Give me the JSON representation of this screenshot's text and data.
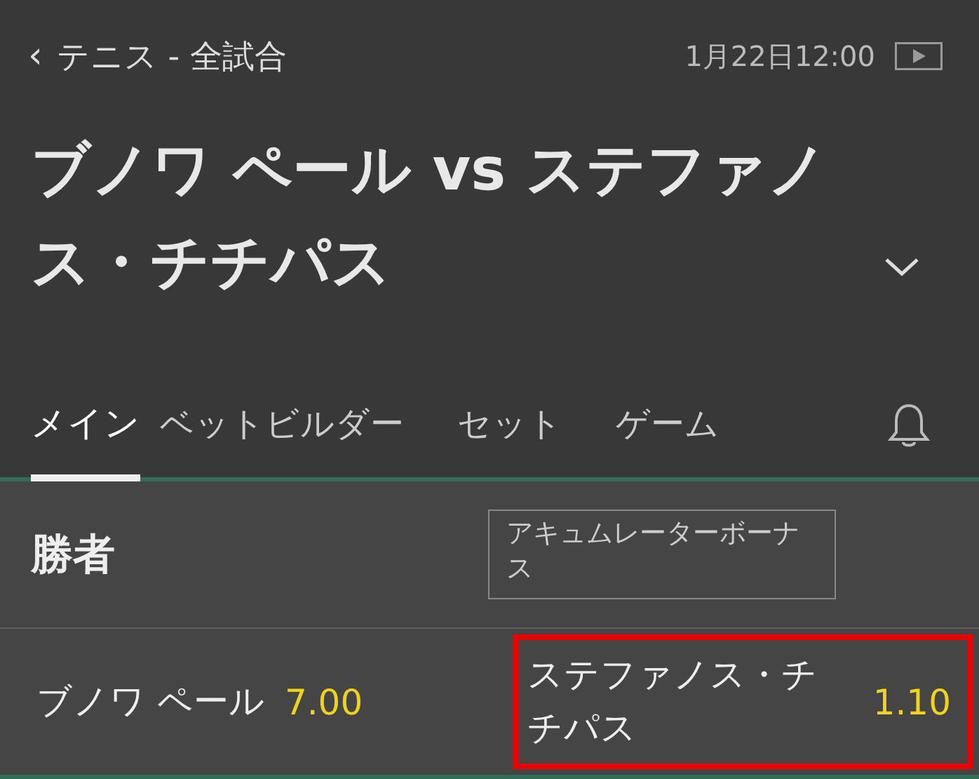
{
  "header": {
    "back": "‹",
    "breadcrumb": "テニス - 全試合",
    "datetime": "1月22日12:00"
  },
  "match": {
    "title": "ブノワ ペール vs ステファノス・チチパス"
  },
  "tabs": [
    {
      "label": "メイン",
      "selected": true
    },
    {
      "label": "ベットビルダー",
      "selected": false
    },
    {
      "label": "セット",
      "selected": false
    },
    {
      "label": "ゲーム",
      "selected": false
    }
  ],
  "market": {
    "title": "勝者",
    "bonus": "アキュムレーターボーナス",
    "outcomes": [
      {
        "name": "ブノワ ペール",
        "odds": "7.00",
        "selected": false
      },
      {
        "name": "ステファノス・チチパス",
        "odds": "1.10",
        "selected": true
      }
    ]
  }
}
